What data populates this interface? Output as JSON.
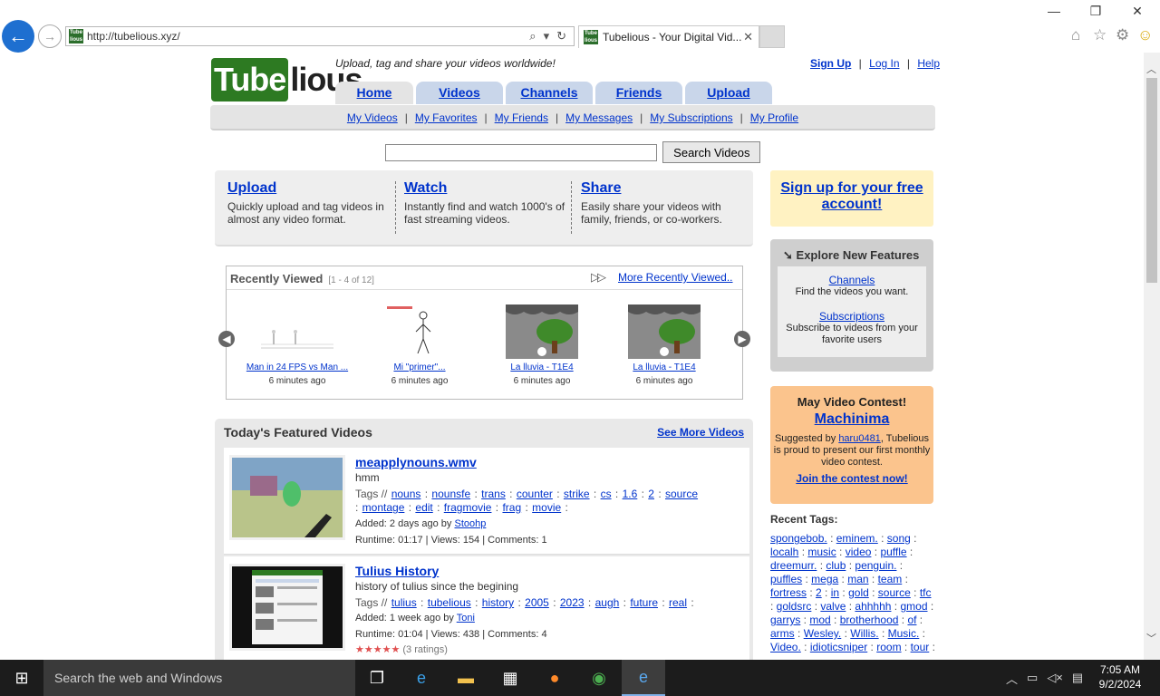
{
  "browser": {
    "url": "http://tubelious.xyz/",
    "tab_title": "Tubelious - Your Digital Vid...",
    "favicon_text": "Tube lious"
  },
  "site": {
    "logo_tube": "Tube",
    "logo_lious": "lious",
    "tagline": "Upload, tag and share your videos worldwide!",
    "top_links": {
      "signup": "Sign Up",
      "login": "Log In",
      "help": "Help",
      "sep": "|"
    },
    "tabs": [
      "Home",
      "Videos",
      "Channels",
      "Friends",
      "Upload"
    ],
    "subnav": [
      "My Videos",
      "My Favorites",
      "My Friends",
      "My Messages",
      "My Subscriptions",
      "My Profile"
    ],
    "search_button": "Search Videos",
    "search_value": ""
  },
  "intro": [
    {
      "title": "Upload",
      "desc": "Quickly upload and tag videos in almost any video format."
    },
    {
      "title": "Watch",
      "desc": "Instantly find and watch 1000's of fast streaming videos."
    },
    {
      "title": "Share",
      "desc": "Easily share your videos with family, friends, or co-workers."
    }
  ],
  "recent": {
    "title": "Recently Viewed",
    "count": "[1 - 4 of 12]",
    "more": "More Recently Viewed..",
    "arrows": "▷▷",
    "items": [
      {
        "caption": "Man in 24 FPS vs Man ...",
        "ago": "6 minutes ago"
      },
      {
        "caption": "Mi \"primer\"...",
        "ago": "6 minutes ago"
      },
      {
        "caption": "La lluvia - T1E4",
        "ago": "6 minutes ago"
      },
      {
        "caption": "La lluvia - T1E4",
        "ago": "6 minutes ago"
      }
    ]
  },
  "featured": {
    "title": "Today's Featured Videos",
    "more": "See More Videos",
    "videos": [
      {
        "title": "meapplynouns.wmv",
        "desc": "hmm",
        "tags_label": "Tags //",
        "tags": [
          "nouns",
          "nounsfe",
          "trans",
          "counter",
          "strike",
          "cs",
          "1.6",
          "2",
          "source",
          "montage",
          "edit",
          "fragmovie",
          "frag",
          "movie"
        ],
        "added_prefix": "Added: 2 days ago by",
        "author": "Stoohp",
        "runtime": "Runtime: 01:17 | Views: 154 | Comments: 1"
      },
      {
        "title": "Tulius History",
        "desc": "history of tulius since the begining",
        "tags_label": "Tags //",
        "tags": [
          "tulius",
          "tubelious",
          "history",
          "2005",
          "2023",
          "augh",
          "future",
          "real"
        ],
        "added_prefix": "Added: 1 week ago by",
        "author": "Toni",
        "runtime": "Runtime: 01:04 | Views: 438 | Comments: 4",
        "ratings": "(3 ratings)"
      }
    ]
  },
  "sidebar": {
    "signup": "Sign up for your free account!",
    "explore_title": "Explore New Features",
    "explore_arrow": "➘",
    "features": [
      {
        "link": "Channels",
        "desc": "Find the videos you want."
      },
      {
        "link": "Subscriptions",
        "desc": "Subscribe to videos from your favorite users"
      }
    ],
    "contest": {
      "title": "May Video Contest!",
      "name": "Machinima",
      "suggested_prefix": "Suggested by",
      "suggested_user": "haru0481",
      "suggested_suffix": ", Tubelious is proud to present our first monthly video contest.",
      "join": "Join the contest now!"
    },
    "recent_tags_title": "Recent Tags:",
    "recent_tags": [
      "spongebob.",
      "eminem.",
      "song",
      "localh",
      "music",
      "video",
      "puffle",
      "dreemurr.",
      "club",
      "penguin.",
      "puffles",
      "mega",
      "man",
      "team",
      "fortress",
      "2",
      "in",
      "gold",
      "source",
      "tfc",
      "goldsrc",
      "valve",
      "ahhhhh",
      "gmod",
      "garrys",
      "mod",
      "brotherhood",
      "of",
      "arms",
      "Wesley.",
      "Willis.",
      "Music.",
      "Video.",
      "idioticsniper",
      "room",
      "tour"
    ]
  },
  "taskbar": {
    "search_placeholder": "Search the web and Windows",
    "time": "7:05 AM",
    "date": "9/2/2024"
  },
  "colors": {
    "link": "#0033cc",
    "logo_green": "#2d7a22",
    "tab_blue": "#c9d6ea",
    "signup_bg": "#fff2c2",
    "contest_bg": "#fbc48d"
  }
}
